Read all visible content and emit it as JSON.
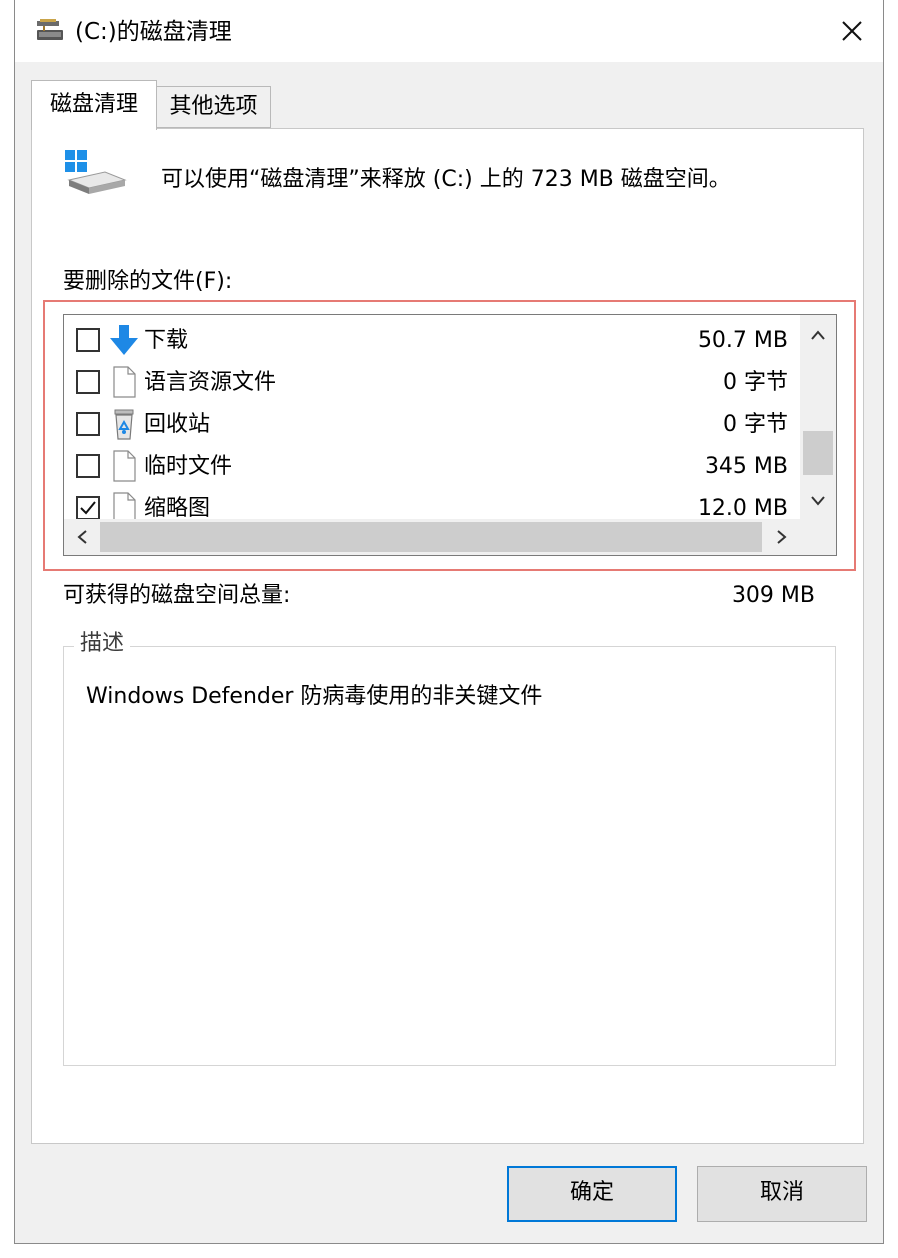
{
  "window": {
    "title": "(C:)的磁盘清理",
    "close_glyph": "✕"
  },
  "tabs": [
    {
      "label": "磁盘清理",
      "active": true
    },
    {
      "label": "其他选项",
      "active": false
    }
  ],
  "header": {
    "message": "可以使用“磁盘清理”来释放 (C:) 上的 723 MB 磁盘空间。"
  },
  "files": {
    "label": "要删除的文件(F):",
    "items": [
      {
        "name": "下载",
        "size": "50.7 MB",
        "checked": false,
        "icon": "download-arrow-icon"
      },
      {
        "name": "语言资源文件",
        "size": "0 字节",
        "checked": false,
        "icon": "file-icon"
      },
      {
        "name": "回收站",
        "size": "0 字节",
        "checked": false,
        "icon": "recycle-bin-icon"
      },
      {
        "name": "临时文件",
        "size": "345 MB",
        "checked": false,
        "icon": "file-icon"
      },
      {
        "name": "缩略图",
        "size": "12.0 MB",
        "checked": true,
        "icon": "file-icon"
      }
    ]
  },
  "total": {
    "label": "可获得的磁盘空间总量:",
    "value": "309 MB"
  },
  "description": {
    "title": "描述",
    "text": "Windows Defender 防病毒使用的非关键文件"
  },
  "buttons": {
    "ok": "确定",
    "cancel": "取消"
  },
  "colors": {
    "accent": "#0078d7",
    "highlight_border": "#e67a74",
    "dialog_bg": "#f0f0f0"
  }
}
